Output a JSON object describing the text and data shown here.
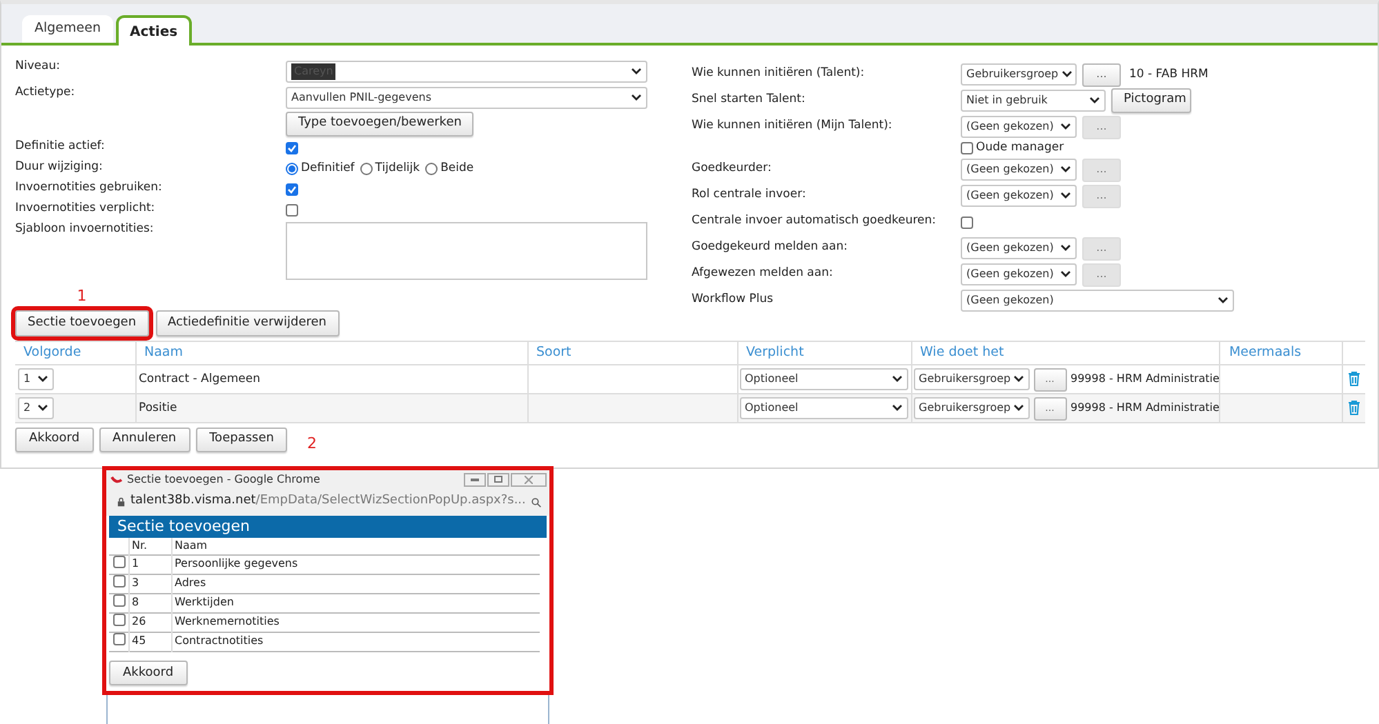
{
  "tabs": [
    {
      "label": "Algemeen",
      "selected": false
    },
    {
      "label": "Acties",
      "selected": true
    }
  ],
  "left_fields": [
    {
      "kind": "select",
      "label": "Niveau:",
      "value": "Careyn",
      "redacted": true
    },
    {
      "kind": "select",
      "label": "Actietype:",
      "value": "Aanvullen PNIL-gegevens",
      "redacted": false,
      "button": "Type toevoegen/bewerken"
    },
    {
      "kind": "checkbox",
      "label": "Definitie actief:",
      "checked": true
    },
    {
      "kind": "radio",
      "label": "Duur wijziging:",
      "options": [
        {
          "label": "Definitief",
          "selected": true
        },
        {
          "label": "Tijdelijk",
          "selected": false
        },
        {
          "label": "Beide",
          "selected": false
        }
      ]
    },
    {
      "kind": "checkbox",
      "label": "Invoernotities gebruiken:",
      "checked": true
    },
    {
      "kind": "checkbox",
      "label": "Invoernotities verplicht:",
      "checked": false
    },
    {
      "kind": "textarea",
      "label": "Sjabloon invoernotities:"
    }
  ],
  "right_fields": [
    {
      "kind": "picker",
      "label": "Wie kunnen initiëren (Talent):",
      "value": "Gebruikersgroep",
      "picker": "...",
      "picker_disabled": false,
      "text": "10 - FAB HRM"
    },
    {
      "kind": "select_button",
      "label": "Snel starten Talent:",
      "value": "Niet in gebruik",
      "button": "Pictogram"
    },
    {
      "kind": "picker",
      "label": "Wie kunnen initiëren (Mijn Talent):",
      "value": "(Geen gekozen)",
      "picker": "...",
      "picker_disabled": true
    },
    {
      "kind": "picker",
      "label": "Goedkeurder:",
      "value": "(Geen gekozen)",
      "picker": "...",
      "picker_disabled": true,
      "checkbox": {
        "label": "Oude manager",
        "checked": false
      }
    },
    {
      "kind": "picker",
      "label": "Rol centrale invoer:",
      "value": "(Geen gekozen)",
      "picker": "...",
      "picker_disabled": true
    },
    {
      "kind": "checkbox",
      "label": "Centrale invoer automatisch goedkeuren:",
      "checked": false
    },
    {
      "kind": "picker",
      "label": "Goedgekeurd melden aan:",
      "value": "(Geen gekozen)",
      "picker": "...",
      "picker_disabled": true
    },
    {
      "kind": "picker",
      "label": "Afgewezen melden aan:",
      "value": "(Geen gekozen)",
      "picker": "...",
      "picker_disabled": true
    },
    {
      "kind": "wide_select",
      "label": "Workflow Plus",
      "value": "(Geen gekozen)"
    }
  ],
  "section_buttons": [
    {
      "label": "Sectie toevoegen",
      "highlighted": true,
      "annotation": "1"
    },
    {
      "label": "Actiedefinitie verwijderen",
      "highlighted": false
    }
  ],
  "table": {
    "columns": [
      "Volgorde",
      "Naam",
      "Soort",
      "Verplicht",
      "Wie doet het",
      "Meermaals"
    ],
    "rows": [
      {
        "order": "1",
        "name": "Contract - Algemeen",
        "required": "Optioneel",
        "who_select": "Gebruikersgroep",
        "who_picker": "...",
        "who": "99998 - HRM Administratie"
      },
      {
        "order": "2",
        "name": "Positie",
        "required": "Optioneel",
        "who_select": "Gebruikersgroep",
        "who_picker": "...",
        "who": "99998 - HRM Administratie"
      }
    ]
  },
  "footer_buttons": [
    "Akkoord",
    "Annuleren",
    "Toepassen"
  ],
  "popup": {
    "annotation": "2",
    "title": "Sectie toevoegen - Google Chrome",
    "url_host": "talent38b.visma.net",
    "url_path": "/EmpData/SelectWizSectionPopUp.aspx?s...",
    "heading": "Sectie toevoegen",
    "columns": [
      "Nr.",
      "Naam"
    ],
    "rows": [
      {
        "nr": "1",
        "name": "Persoonlijke gegevens",
        "checked": false
      },
      {
        "nr": "3",
        "name": "Adres",
        "checked": false
      },
      {
        "nr": "8",
        "name": "Werktijden",
        "checked": false
      },
      {
        "nr": "26",
        "name": "Werknemernotities",
        "checked": false
      },
      {
        "nr": "45",
        "name": "Contractnotities",
        "checked": false
      }
    ],
    "button": "Akkoord"
  }
}
